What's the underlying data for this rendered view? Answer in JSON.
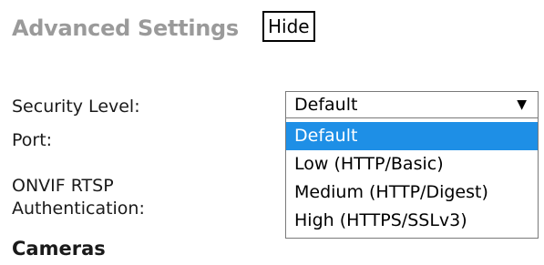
{
  "advanced_settings": {
    "title": "Advanced Settings",
    "hide_label": "Hide"
  },
  "form": {
    "security_level_label": "Security Level:",
    "port_label": "Port:",
    "onvif_label_line1": "ONVIF RTSP",
    "onvif_label_line2": "Authentication:"
  },
  "security_select": {
    "selected_value": "Default",
    "arrow_icon": "triangle-down",
    "options": [
      "Default",
      "Low (HTTP/Basic)",
      "Medium (HTTP/Digest)",
      "High (HTTPS/SSLv3)"
    ],
    "highlighted_index": 0,
    "highlight_color": "#1e8fe6"
  },
  "cameras": {
    "heading": "Cameras"
  }
}
